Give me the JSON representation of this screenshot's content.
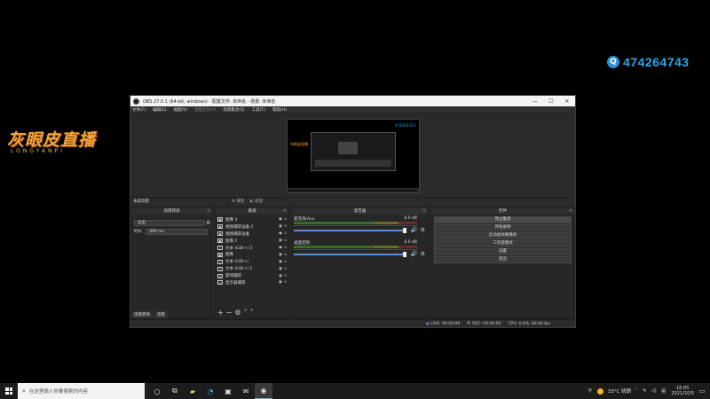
{
  "overlay": {
    "logo_main": "灰眼皮直播",
    "logo_sub": "LONGYANPI",
    "qq_number": "474264743"
  },
  "window": {
    "title": "OBS 27.0.1 (64-bit, windows) - 配置文件: 未命名 - 场景: 未命名",
    "menus": [
      "文件(F)",
      "编辑(E)",
      "视图(V)",
      "配置文件(P)",
      "场景集合(S)",
      "工具(T)",
      "帮助(H)"
    ]
  },
  "scene_bar": {
    "label": "未选场景",
    "properties": "属性",
    "filters": "滤镜"
  },
  "preview": {
    "tag": "灰眼皮直播",
    "qq": "474264743"
  },
  "transitions": {
    "title": "场景转场",
    "selected": "淡出",
    "duration_label": "时长",
    "duration_value": "300 ms",
    "tabs": [
      "场景转场",
      "场景"
    ]
  },
  "sources": {
    "title": "来源",
    "items": [
      {
        "icon": "image",
        "name": "图像 3"
      },
      {
        "icon": "video",
        "name": "视频捕获设备 2"
      },
      {
        "icon": "video",
        "name": "视频捕获设备"
      },
      {
        "icon": "image",
        "name": "图像 2"
      },
      {
        "icon": "text",
        "name": "文本 (GDI+) 3"
      },
      {
        "icon": "image",
        "name": "图像"
      },
      {
        "icon": "text",
        "name": "文本 (GDI+)"
      },
      {
        "icon": "text",
        "name": "文本 (GDI+) 2"
      },
      {
        "icon": "game",
        "name": "游戏捕获"
      },
      {
        "icon": "display",
        "name": "显示器捕获"
      }
    ]
  },
  "mixer": {
    "title": "混音器",
    "channels": [
      {
        "name": "麦克风/Aux",
        "db": "0.0 dB"
      },
      {
        "name": "桌面音频",
        "db": "0.0 dB"
      }
    ]
  },
  "controls": {
    "title": "控件",
    "buttons": [
      "停止推流",
      "开始录制",
      "启动虚拟摄像机",
      "工作室模式",
      "设置",
      "退出"
    ]
  },
  "status": {
    "live": "LIVE: 00:00:00",
    "rec": "REC: 00:00:00",
    "cpu": "CPU: 0.6%, 60.00 fps"
  },
  "taskbar": {
    "search_placeholder": "在这里输入你要搜索的内容",
    "weather": "33°C 晴朗",
    "ime": "英",
    "time": "16:05",
    "date": "2021/10/5"
  }
}
